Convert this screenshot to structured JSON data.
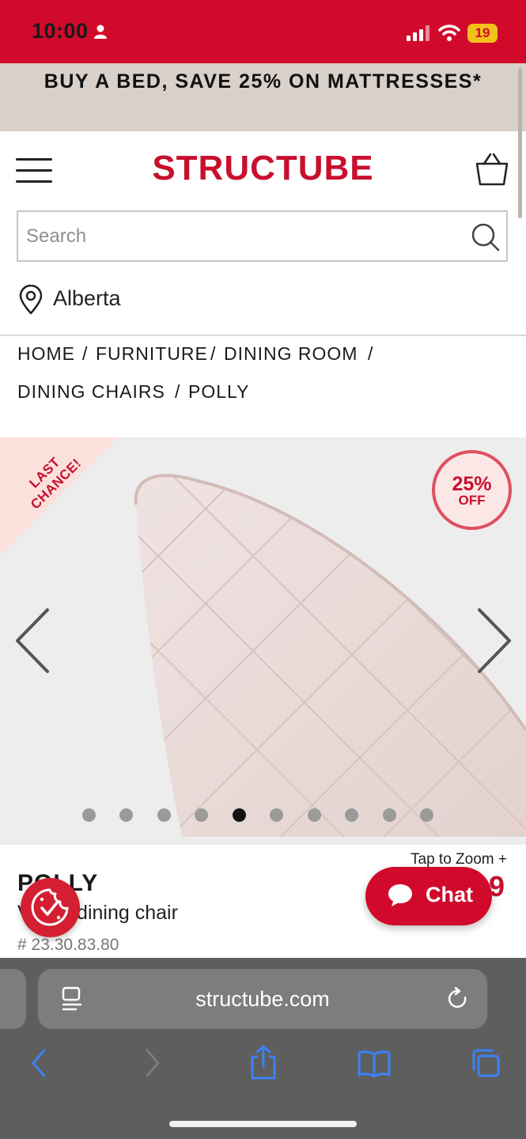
{
  "status_bar": {
    "time": "10:00",
    "battery": "19"
  },
  "promo": {
    "text": "BUY A BED, SAVE 25% ON MATTRESSES*"
  },
  "header": {
    "logo": "STRUCTUBE"
  },
  "search": {
    "placeholder": "Search"
  },
  "location": {
    "province": "Alberta"
  },
  "breadcrumb": [
    {
      "label": "HOME"
    },
    {
      "label": "FURNITURE"
    },
    {
      "label": "DINING ROOM"
    },
    {
      "label": "DINING CHAIRS"
    },
    {
      "label": "POLLY"
    }
  ],
  "breadcrumb_sep": "/",
  "gallery": {
    "ribbon_line1": "LAST",
    "ribbon_line2": "CHANCE!",
    "discount_pct": "25%",
    "discount_label": "OFF",
    "image_count": 10,
    "active_index": 4,
    "tap_to_zoom": "Tap to Zoom +"
  },
  "product": {
    "name": "POLLY",
    "description": "Velvet dining chair",
    "sku": "# 23.30.83.80",
    "price_partial": "9"
  },
  "chat": {
    "label": "Chat"
  },
  "browser": {
    "url": "structube.com"
  },
  "colors": {
    "brand_red": "#c8102e",
    "status_red": "#d10a2b",
    "promo_bg": "#d8d0c9"
  }
}
